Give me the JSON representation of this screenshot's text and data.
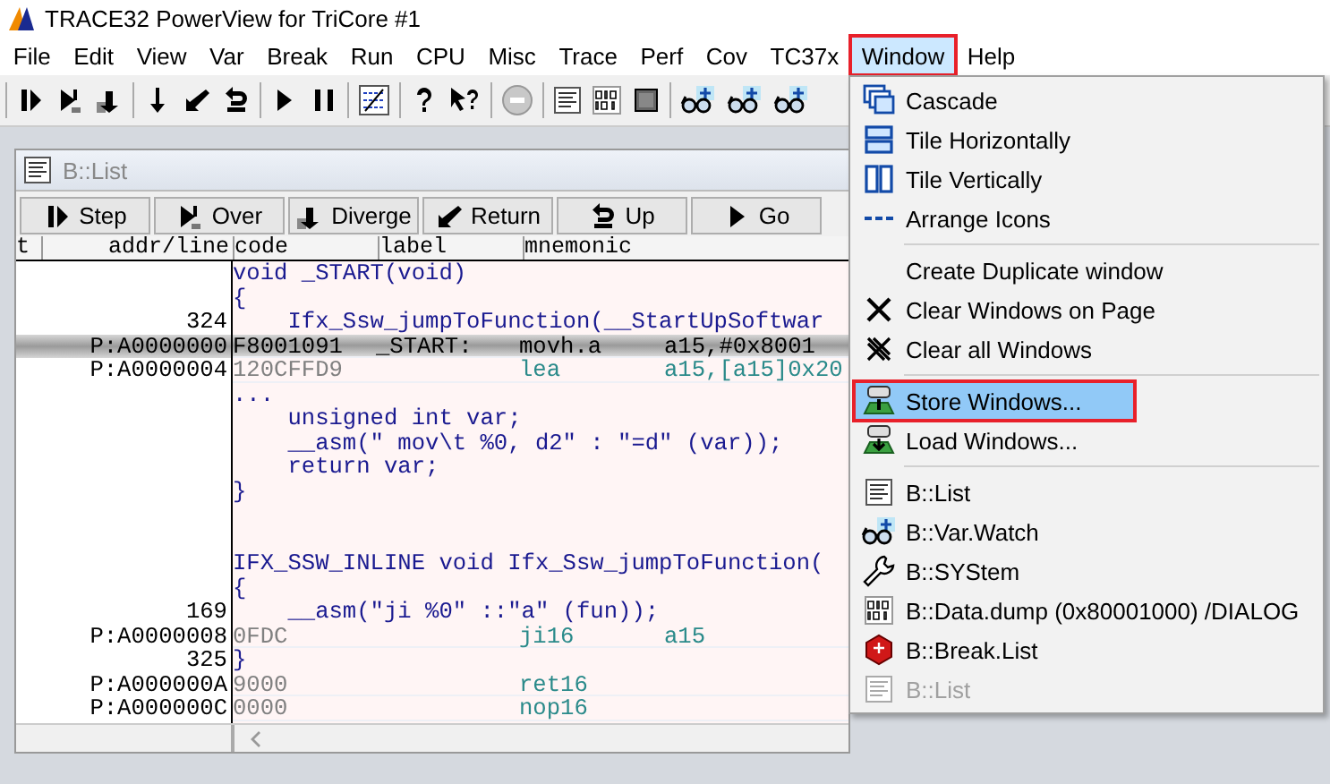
{
  "window": {
    "title": "TRACE32 PowerView for TriCore #1"
  },
  "menu_bar": [
    {
      "label": "File",
      "selected": false,
      "annotated": false
    },
    {
      "label": "Edit",
      "selected": false,
      "annotated": false
    },
    {
      "label": "View",
      "selected": false,
      "annotated": false
    },
    {
      "label": "Var",
      "selected": false,
      "annotated": false
    },
    {
      "label": "Break",
      "selected": false,
      "annotated": false
    },
    {
      "label": "Run",
      "selected": false,
      "annotated": false
    },
    {
      "label": "CPU",
      "selected": false,
      "annotated": false
    },
    {
      "label": "Misc",
      "selected": false,
      "annotated": false
    },
    {
      "label": "Trace",
      "selected": false,
      "annotated": false
    },
    {
      "label": "Perf",
      "selected": false,
      "annotated": false
    },
    {
      "label": "Cov",
      "selected": false,
      "annotated": false
    },
    {
      "label": "TC37x",
      "selected": false,
      "annotated": false
    },
    {
      "label": "Window",
      "selected": true,
      "annotated": true
    },
    {
      "label": "Help",
      "selected": false,
      "annotated": false
    }
  ],
  "list_window": {
    "title": "B::List",
    "buttons": [
      "Step",
      "Over",
      "Diverge",
      "Return",
      "Up",
      "Go"
    ],
    "columns": [
      "t",
      "addr/line",
      "code",
      "label",
      "mnemonic"
    ],
    "rows": [
      {
        "kind": "source",
        "addr": "",
        "text": "void _START(void)",
        "selected": false
      },
      {
        "kind": "source",
        "addr": "",
        "text": "{",
        "selected": false
      },
      {
        "kind": "source",
        "addr": "324",
        "text": "    Ifx_Ssw_jumpToFunction(__StartUpSoftwar",
        "selected": false
      },
      {
        "kind": "asm",
        "addr": "P:A0000000",
        "opcode": "F8001091",
        "label": "_START:",
        "mnemonic": "movh.a",
        "operands": "a15,#0x8001",
        "selected": true
      },
      {
        "kind": "asm",
        "addr": "P:A0000004",
        "opcode": "120CFFD9",
        "label": "",
        "mnemonic": "lea",
        "operands": "a15,[a15]0x20",
        "selected": false
      },
      {
        "kind": "source",
        "addr": "",
        "text": "...",
        "selected": false
      },
      {
        "kind": "source",
        "addr": "",
        "text": "    unsigned int var;",
        "selected": false
      },
      {
        "kind": "source",
        "addr": "",
        "text": "    __asm(\" mov\\t %0, d2\" : \"=d\" (var));",
        "selected": false
      },
      {
        "kind": "source",
        "addr": "",
        "text": "    return var;",
        "selected": false
      },
      {
        "kind": "source",
        "addr": "",
        "text": "}",
        "selected": false
      },
      {
        "kind": "blank",
        "selected": false
      },
      {
        "kind": "blank",
        "selected": false
      },
      {
        "kind": "source",
        "addr": "",
        "text": "IFX_SSW_INLINE void Ifx_Ssw_jumpToFunction(",
        "selected": false
      },
      {
        "kind": "source",
        "addr": "",
        "text": "{",
        "selected": false
      },
      {
        "kind": "source",
        "addr": "169",
        "text": "    __asm(\"ji %0\" ::\"a\" (fun));",
        "selected": false
      },
      {
        "kind": "asm",
        "addr": "P:A0000008",
        "opcode": "0FDC",
        "label": "",
        "mnemonic": "ji16",
        "operands": "a15",
        "selected": false
      },
      {
        "kind": "source",
        "addr": "325",
        "text": "}",
        "selected": false
      },
      {
        "kind": "asm",
        "addr": "P:A000000A",
        "opcode": "9000",
        "label": "",
        "mnemonic": "ret16",
        "operands": "",
        "selected": false
      },
      {
        "kind": "asm",
        "addr": "P:A000000C",
        "opcode": "0000",
        "label": "",
        "mnemonic": "nop16",
        "operands": "",
        "selected": false
      }
    ]
  },
  "window_menu": {
    "groups": [
      [
        {
          "label": "Cascade",
          "selected": false,
          "disabled": false,
          "annotated": false
        },
        {
          "label": "Tile Horizontally",
          "selected": false,
          "disabled": false,
          "annotated": false
        },
        {
          "label": "Tile Vertically",
          "selected": false,
          "disabled": false,
          "annotated": false
        },
        {
          "label": "Arrange Icons",
          "selected": false,
          "disabled": false,
          "annotated": false
        }
      ],
      [
        {
          "label": "Create Duplicate window",
          "selected": false,
          "disabled": false,
          "annotated": false
        },
        {
          "label": "Clear Windows on Page",
          "selected": false,
          "disabled": false,
          "annotated": false
        },
        {
          "label": "Clear all Windows",
          "selected": false,
          "disabled": false,
          "annotated": false
        }
      ],
      [
        {
          "label": "Store Windows...",
          "selected": true,
          "disabled": false,
          "annotated": true
        },
        {
          "label": "Load Windows...",
          "selected": false,
          "disabled": false,
          "annotated": false
        }
      ],
      [
        {
          "label": "B::List",
          "selected": false,
          "disabled": false,
          "annotated": false
        },
        {
          "label": "B::Var.Watch",
          "selected": false,
          "disabled": false,
          "annotated": false
        },
        {
          "label": "B::SYStem",
          "selected": false,
          "disabled": false,
          "annotated": false
        },
        {
          "label": "B::Data.dump (0x80001000) /DIALOG",
          "selected": false,
          "disabled": false,
          "annotated": false
        },
        {
          "label": "B::Break.List",
          "selected": false,
          "disabled": false,
          "annotated": false
        },
        {
          "label": "B::List",
          "selected": false,
          "disabled": true,
          "annotated": false
        }
      ]
    ]
  }
}
